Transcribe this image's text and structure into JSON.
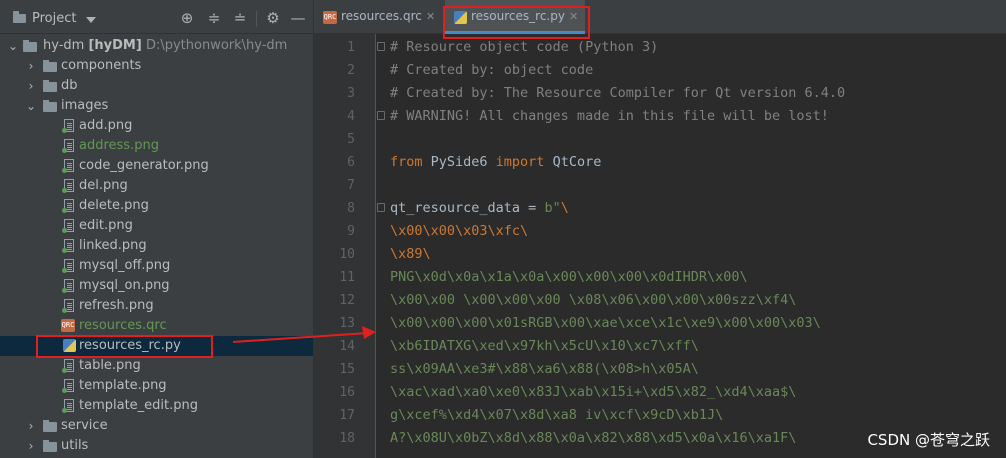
{
  "project_panel": {
    "title": "Project",
    "root": {
      "name": "hy-dm",
      "module": "[hyDM]",
      "path": "D:\\pythonwork\\hy-dm"
    },
    "items": [
      {
        "label": "components",
        "kind": "folder"
      },
      {
        "label": "db",
        "kind": "folder"
      },
      {
        "label": "images",
        "kind": "folder"
      },
      {
        "label": "add.png",
        "kind": "png"
      },
      {
        "label": "address.png",
        "kind": "png"
      },
      {
        "label": "code_generator.png",
        "kind": "png"
      },
      {
        "label": "del.png",
        "kind": "png"
      },
      {
        "label": "delete.png",
        "kind": "png"
      },
      {
        "label": "edit.png",
        "kind": "png"
      },
      {
        "label": "linked.png",
        "kind": "png"
      },
      {
        "label": "mysql_off.png",
        "kind": "png"
      },
      {
        "label": "mysql_on.png",
        "kind": "png"
      },
      {
        "label": "refresh.png",
        "kind": "png"
      },
      {
        "label": "resources.qrc",
        "kind": "qrc"
      },
      {
        "label": "resources_rc.py",
        "kind": "py"
      },
      {
        "label": "table.png",
        "kind": "png"
      },
      {
        "label": "template.png",
        "kind": "png"
      },
      {
        "label": "template_edit.png",
        "kind": "png"
      },
      {
        "label": "service",
        "kind": "folder"
      },
      {
        "label": "utils",
        "kind": "folder"
      }
    ]
  },
  "tabs": [
    {
      "label": "resources.qrc",
      "active": false
    },
    {
      "label": "resources_rc.py",
      "active": true
    }
  ],
  "editor": {
    "line_numbers": [
      "1",
      "2",
      "3",
      "4",
      "5",
      "6",
      "7",
      "8",
      "9",
      "10",
      "11",
      "12",
      "13",
      "14",
      "15",
      "16",
      "17",
      "18"
    ],
    "lines": {
      "l1": "# Resource object code (Python 3)",
      "l2": "# Created by: object code",
      "l3": "# Created by: The Resource Compiler for Qt version 6.4.0",
      "l4": "# WARNING! All changes made in this file will be lost!",
      "l6_kw1": "from",
      "l6_mod": " PySide6 ",
      "l6_kw2": "import",
      "l6_name": " QtCore",
      "l8_var": "qt_resource_data = ",
      "l8_str": "b\"",
      "l8_esc": "\\",
      "l9": "\\x00\\x00\\x03\\xfc\\",
      "l10": "\\x89\\",
      "l11": "PNG\\x0d\\x0a\\x1a\\x0a\\x00\\x00\\x00\\x0dIHDR\\x00\\",
      "l12": "\\x00\\x00 \\x00\\x00\\x00 \\x08\\x06\\x00\\x00\\x00szz\\xf4\\",
      "l13": "\\x00\\x00\\x00\\x01sRGB\\x00\\xae\\xce\\x1c\\xe9\\x00\\x00\\x03\\",
      "l14": "\\xb6IDATXG\\xed\\x97kh\\x5cU\\x10\\xc7\\xff\\",
      "l15": "ss\\x09AA\\xe3#\\x88\\xa6\\x88(\\x08>h\\x05A\\",
      "l16": "\\xac\\xad\\xa0\\xe0\\x83J\\xab\\x15i+\\xd5\\x82_\\xd4\\xaa$\\",
      "l17": "g\\xcef%\\xd4\\x07\\x8d\\xa8 iv\\xcf\\x9cD\\xb1J\\",
      "l18": "A?\\x08U\\x0bZ\\x8d\\x88\\x0a\\x82\\x88\\xd5\\x0a\\x16\\xa1F\\"
    }
  },
  "watermark": "CSDN @苍穹之跃",
  "colors": {
    "annotation": "#e02020",
    "selection": "#0d293e"
  }
}
